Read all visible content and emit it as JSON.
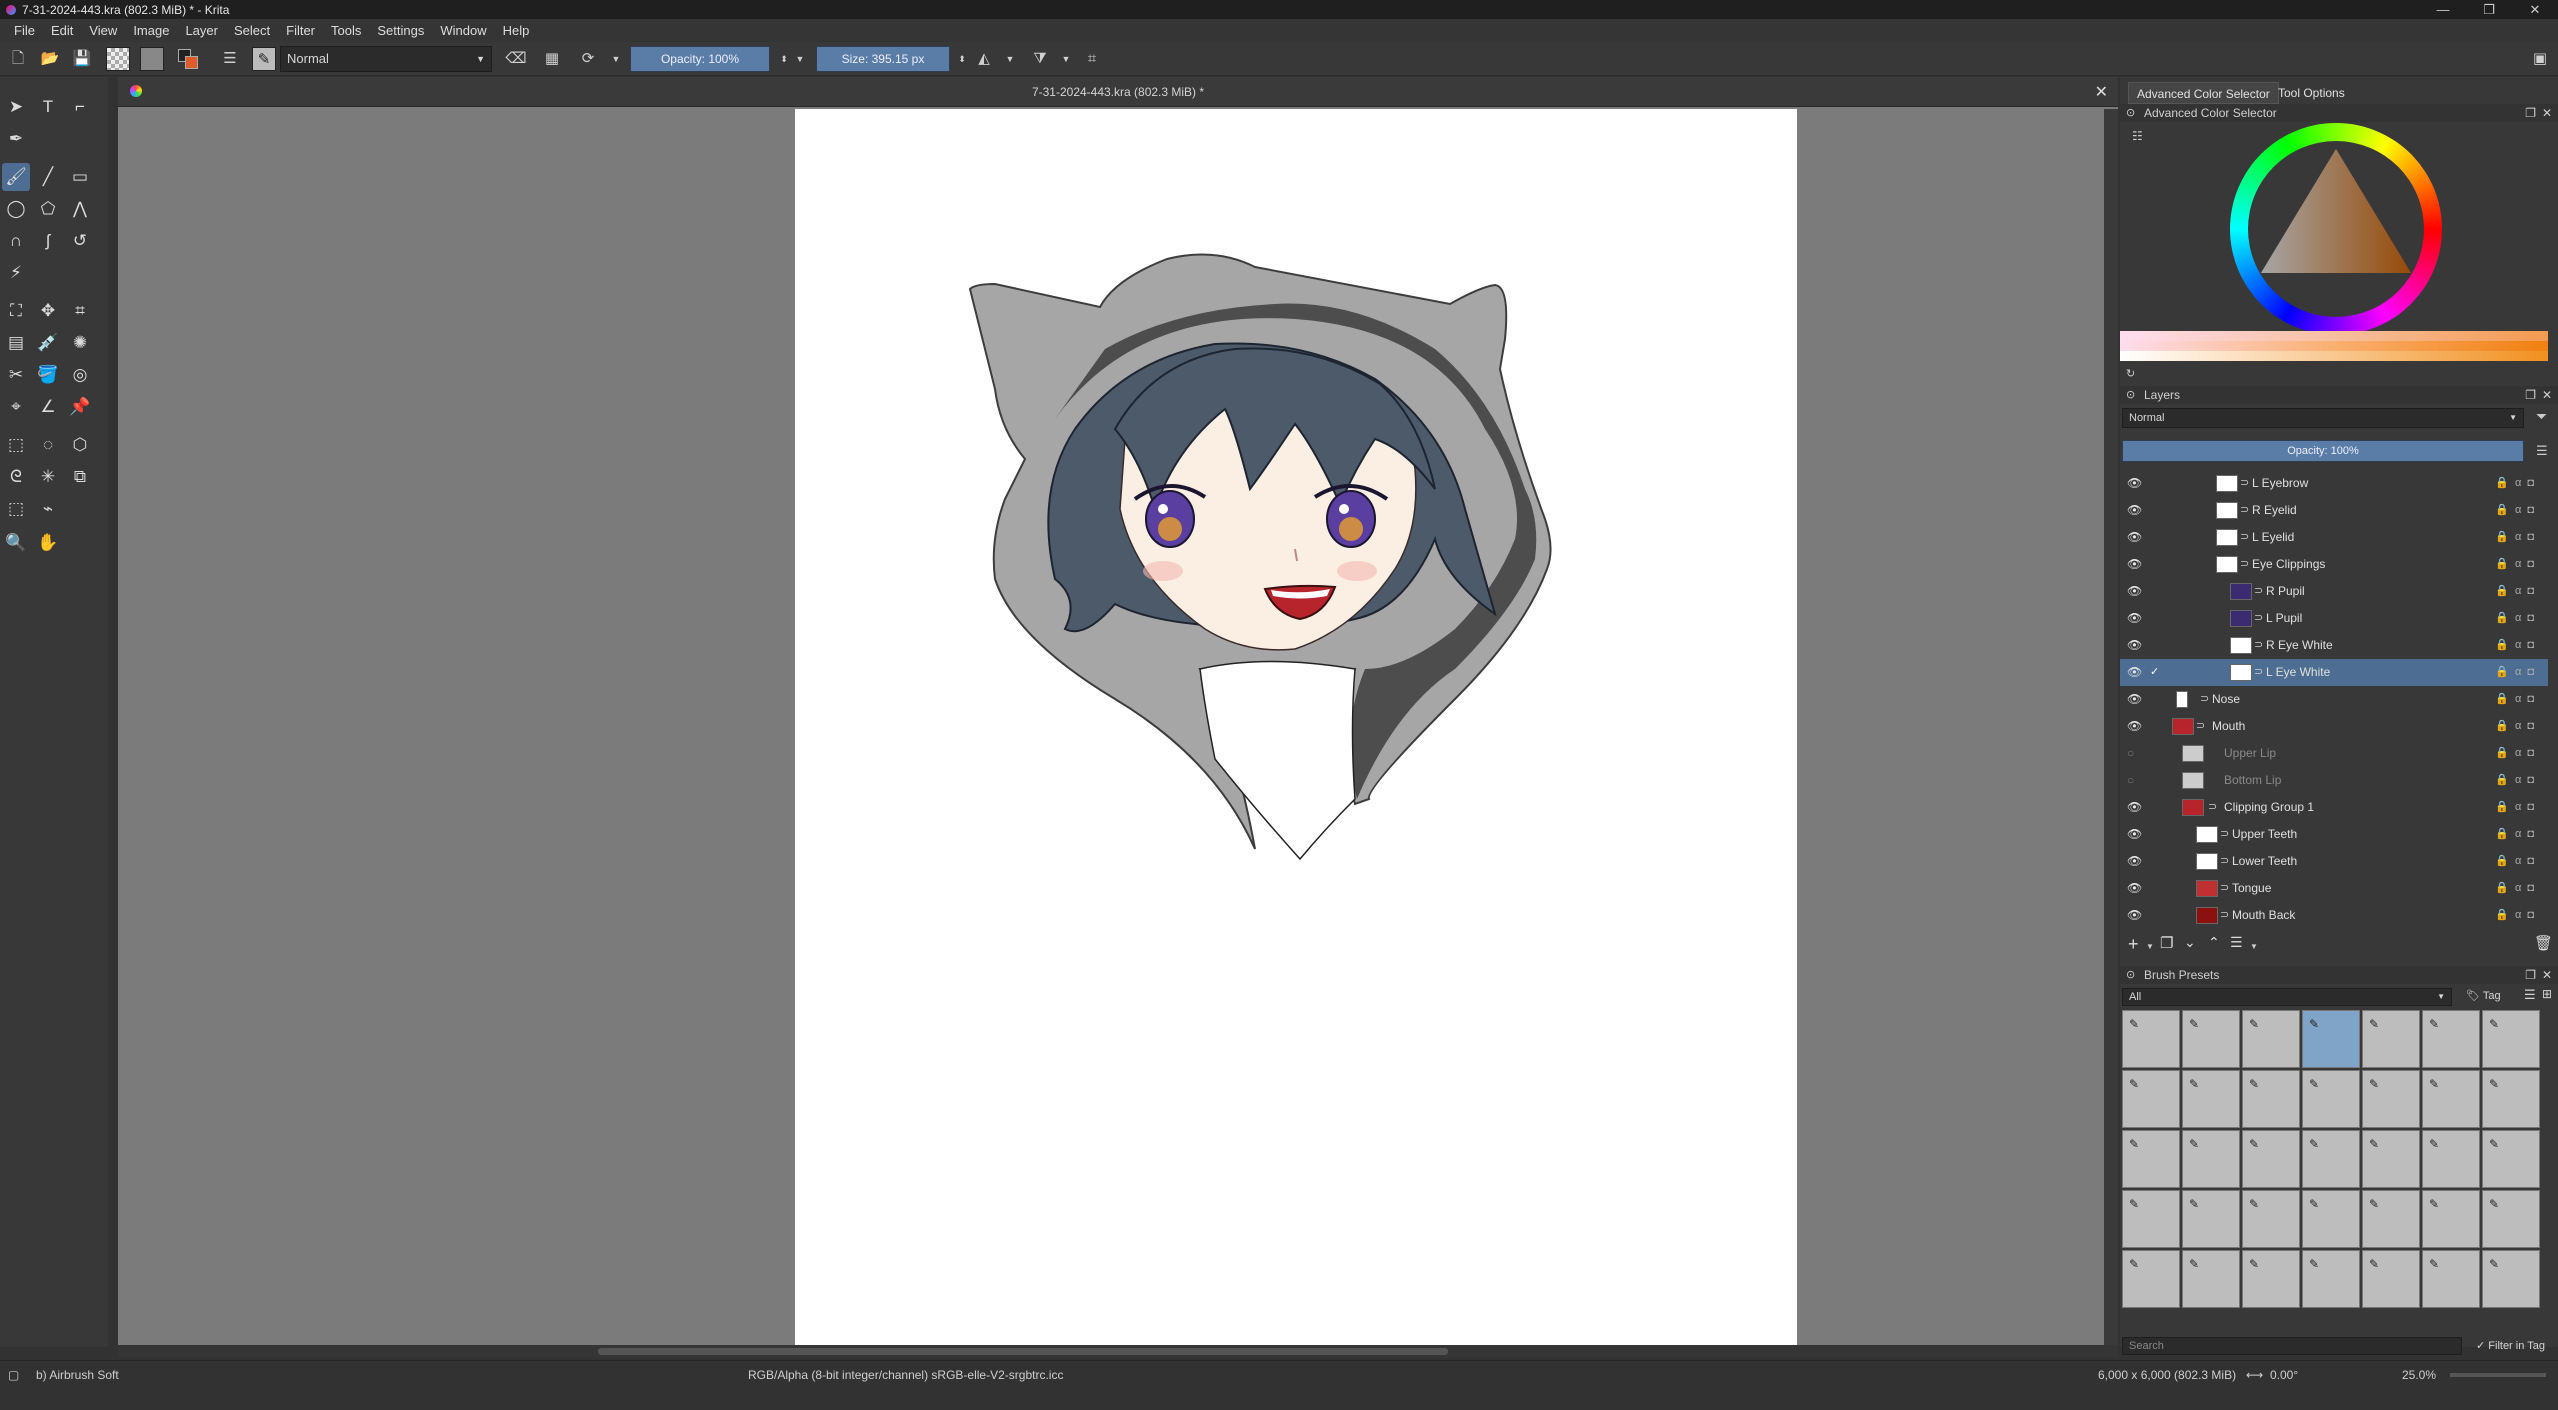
{
  "window": {
    "title": "7-31-2024-443.kra (802.3 MiB) * - Krita"
  },
  "menu": [
    "File",
    "Edit",
    "View",
    "Image",
    "Layer",
    "Select",
    "Filter",
    "Tools",
    "Settings",
    "Window",
    "Help"
  ],
  "toolbar": {
    "blend_mode": "Normal",
    "opacity": "Opacity: 100%",
    "size": "Size: 395.15 px"
  },
  "document": {
    "tab_title": "7-31-2024-443.kra (802.3 MiB) *"
  },
  "color_selector": {
    "tabs": [
      "Advanced Color Selector",
      "Tool Options"
    ],
    "header": "Advanced Color Selector"
  },
  "layers_panel": {
    "header": "Layers",
    "blend_mode": "Normal",
    "opacity": "Opacity:  100%",
    "layers": [
      {
        "name": "L Eyebrow"
      },
      {
        "name": "R Eyelid"
      },
      {
        "name": "L Eyelid"
      },
      {
        "name": "Eye Clippings"
      },
      {
        "name": "R Pupil"
      },
      {
        "name": "L Pupil"
      },
      {
        "name": "R Eye White"
      },
      {
        "name": "L Eye White"
      },
      {
        "name": "Nose"
      },
      {
        "name": "Mouth"
      },
      {
        "name": "Upper Lip"
      },
      {
        "name": "Bottom Lip"
      },
      {
        "name": "Clipping Group 1"
      },
      {
        "name": "Upper Teeth"
      },
      {
        "name": "Lower Teeth"
      },
      {
        "name": "Tongue"
      },
      {
        "name": "Mouth Back"
      }
    ]
  },
  "brush_presets": {
    "header": "Brush Presets",
    "filter": "All",
    "tag_label": "Tag",
    "search_placeholder": "Search",
    "filter_in_tag": "Filter in Tag"
  },
  "status": {
    "brush": "b) Airbrush Soft",
    "color_info": "RGB/Alpha (8-bit integer/channel)  sRGB-elle-V2-srgbtrc.icc",
    "dimensions": "6,000 x 6,000 (802.3 MiB)",
    "rotation": "0.00°",
    "zoom": "25.0%"
  }
}
